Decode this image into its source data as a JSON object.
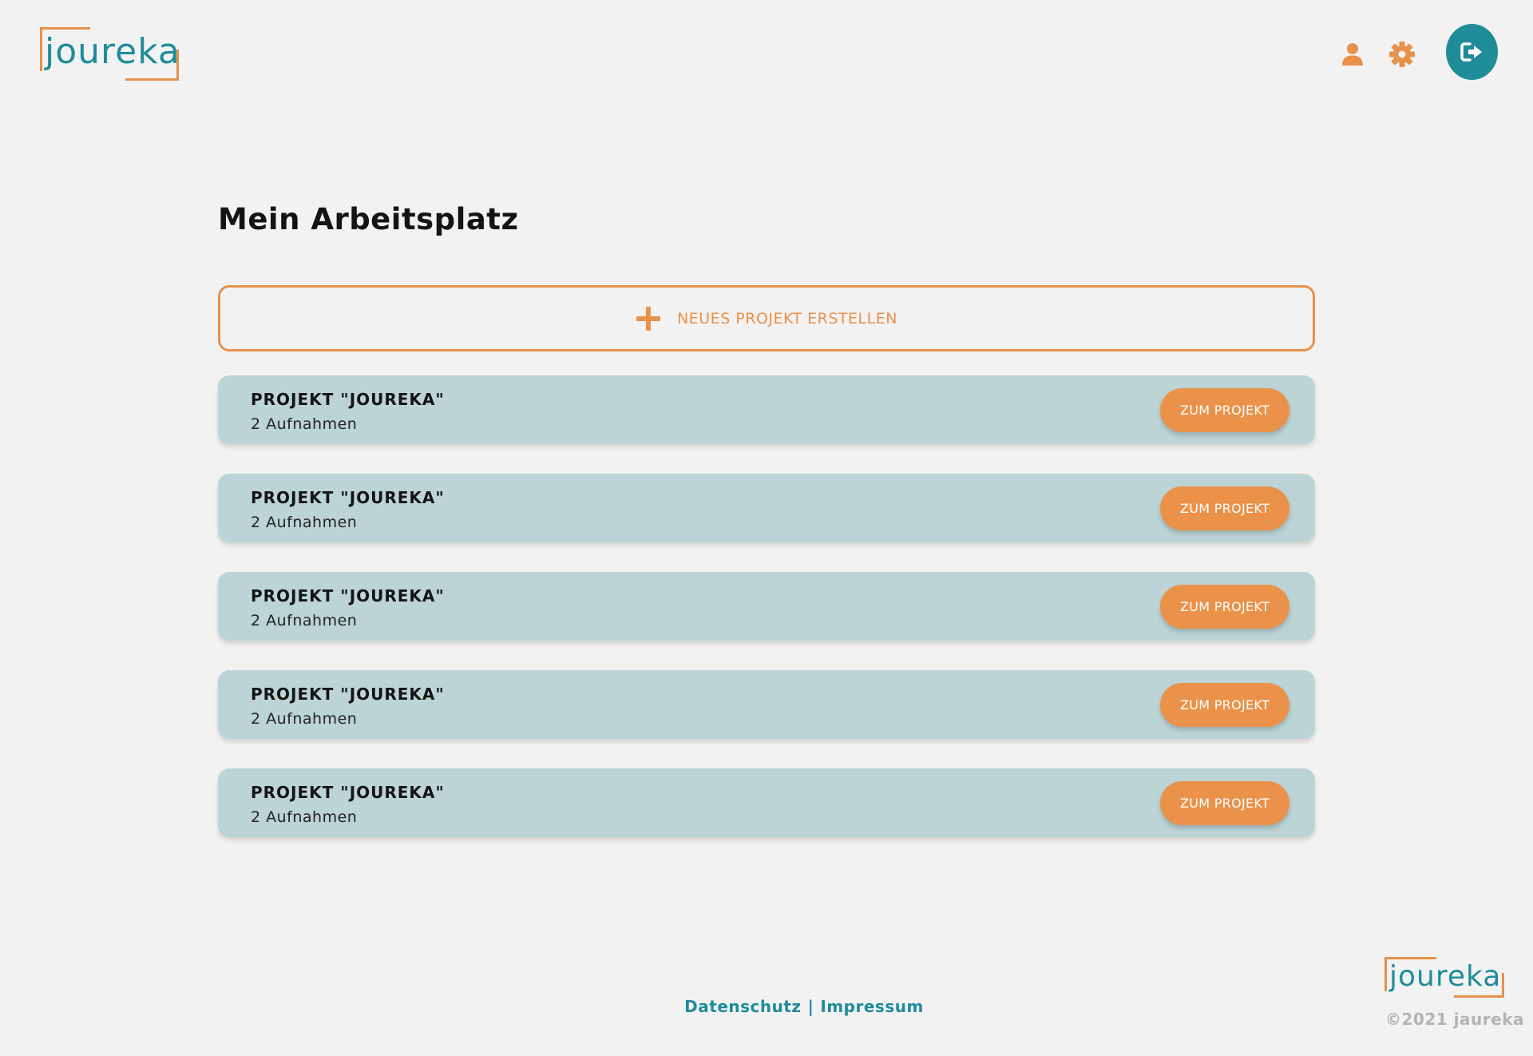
{
  "brand": {
    "logo_text": "joureka",
    "accent_color": "#e8914a",
    "primary_color": "#1f8c9a",
    "card_color": "#bcd4d6"
  },
  "header": {
    "icons": [
      "user-icon",
      "gear-icon",
      "logout-icon"
    ]
  },
  "main": {
    "title": "Mein Arbeitsplatz",
    "new_project_label": "NEUES PROJEKT ERSTELLEN",
    "projects": [
      {
        "name": "PROJEKT \"JOUREKA\"",
        "count": "2 Aufnahmen",
        "button": "ZUM PROJEKT"
      },
      {
        "name": "PROJEKT \"JOUREKA\"",
        "count": "2 Aufnahmen",
        "button": "ZUM PROJEKT"
      },
      {
        "name": "PROJEKT \"JOUREKA\"",
        "count": "2 Aufnahmen",
        "button": "ZUM PROJEKT"
      },
      {
        "name": "PROJEKT \"JOUREKA\"",
        "count": "2 Aufnahmen",
        "button": "ZUM PROJEKT"
      },
      {
        "name": "PROJEKT \"JOUREKA\"",
        "count": "2 Aufnahmen",
        "button": "ZUM PROJEKT"
      }
    ]
  },
  "footer": {
    "datenschutz": "Datenschutz",
    "separator": "|",
    "impressum": "Impressum",
    "logo_text": "joureka",
    "copyright": "©2021 jaureka"
  }
}
